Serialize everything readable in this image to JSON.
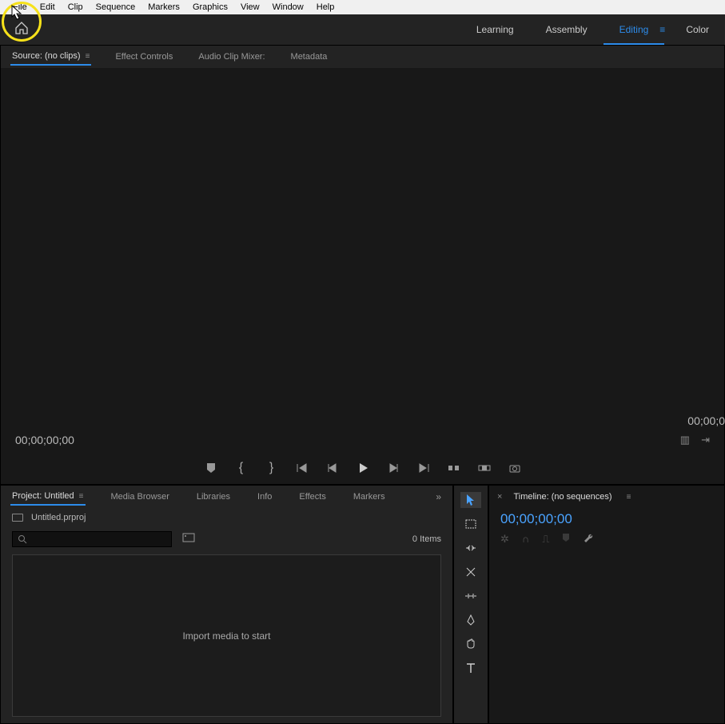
{
  "menu": [
    "File",
    "Edit",
    "Clip",
    "Sequence",
    "Markers",
    "Graphics",
    "View",
    "Window",
    "Help"
  ],
  "workspaces": {
    "items": [
      "Learning",
      "Assembly",
      "Editing",
      "Color"
    ],
    "activeIndex": 2
  },
  "sourcePanel": {
    "tabs": [
      "Source: (no clips)",
      "Effect Controls",
      "Audio Clip Mixer:",
      "Metadata"
    ],
    "activeIndex": 0,
    "timecodeLeft": "00;00;00;00",
    "timecodeRight": "00;00;0"
  },
  "projectPanel": {
    "tabs": [
      "Project: Untitled",
      "Media Browser",
      "Libraries",
      "Info",
      "Effects",
      "Markers"
    ],
    "activeIndex": 0,
    "projectFile": "Untitled.prproj",
    "itemsCount": "0 Items",
    "emptyText": "Import media to start",
    "searchPlaceholder": ""
  },
  "toolbox": {
    "tools": [
      "selection",
      "marquee",
      "ripple",
      "rate-stretch",
      "razor",
      "pen",
      "hand",
      "type"
    ],
    "activeIndex": 0
  },
  "timelinePanel": {
    "title": "Timeline: (no sequences)",
    "timecode": "00;00;00;00"
  },
  "transport": [
    "marker",
    "in",
    "out",
    "goto-in",
    "step-back",
    "play",
    "step-fwd",
    "goto-out",
    "insert",
    "overwrite",
    "export-frame"
  ]
}
